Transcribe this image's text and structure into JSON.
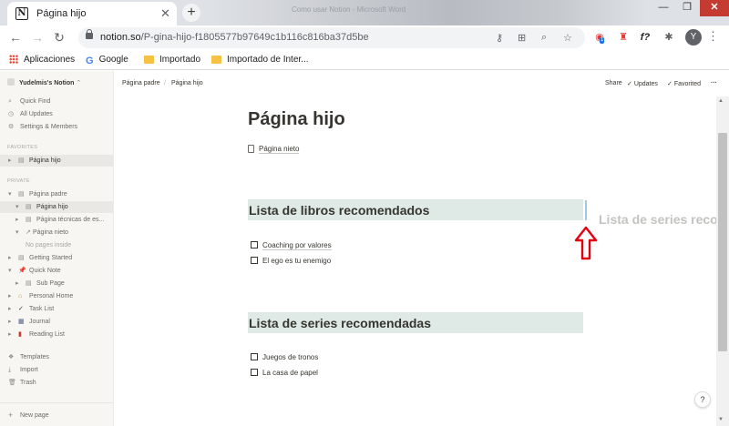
{
  "browser": {
    "tab_title": "Página hijo",
    "tab_close": "✕",
    "new_tab": "+",
    "background_window_text": "Como usar Notion - Microsoft Word",
    "url_host": "notion.so",
    "url_path": "/P-gina-hijo-f1805577b97649c1b116c816ba37d5be",
    "profile_initial": "Y",
    "ext_badge": "1",
    "ext_f_label": "f?"
  },
  "bookmarks": {
    "items": [
      "Aplicaciones",
      "Google",
      "Importado",
      "Importado de Inter..."
    ]
  },
  "sidebar": {
    "workspace": "Yudelmis's Notion",
    "workspace_chevron": "⌃",
    "top_items": [
      "Quick Find",
      "All Updates",
      "Settings & Members"
    ],
    "favorites_label": "FAVORITES",
    "favorites": [
      "Página hijo"
    ],
    "private_label": "PRIVATE",
    "private_items": [
      "Página padre",
      "Página hijo",
      "Página técnicas de es...",
      "Página nieto",
      "No pages inside",
      "Getting Started",
      "Quick Note",
      "Sub Page",
      "Personal Home",
      "Task List",
      "Journal",
      "Reading List"
    ],
    "bottom_items": [
      "Templates",
      "Import",
      "Trash"
    ],
    "new_page": "New page"
  },
  "topbar": {
    "breadcrumb": [
      "Página padre",
      "Página hijo"
    ],
    "breadcrumb_sep": "/",
    "actions": [
      "Share",
      "Updates",
      "Favorited"
    ]
  },
  "page": {
    "title": "Página hijo",
    "subpage_link": "Página nieto",
    "heading_books": "Lista de libros recomendados",
    "books": [
      "Coaching por valores",
      "El ego es tu enemigo"
    ],
    "heading_series": "Lista de series recomendadas",
    "series": [
      "Juegos de tronos",
      "La casa de papel"
    ],
    "dragging_ghost": "Lista de series recom"
  },
  "help": "?",
  "colors": {
    "heading_bg": "#dfeae6",
    "drop_indicator": "#9ec9ea",
    "annotation": "#e3000f",
    "sidebar_bg": "#f7f6f3"
  }
}
